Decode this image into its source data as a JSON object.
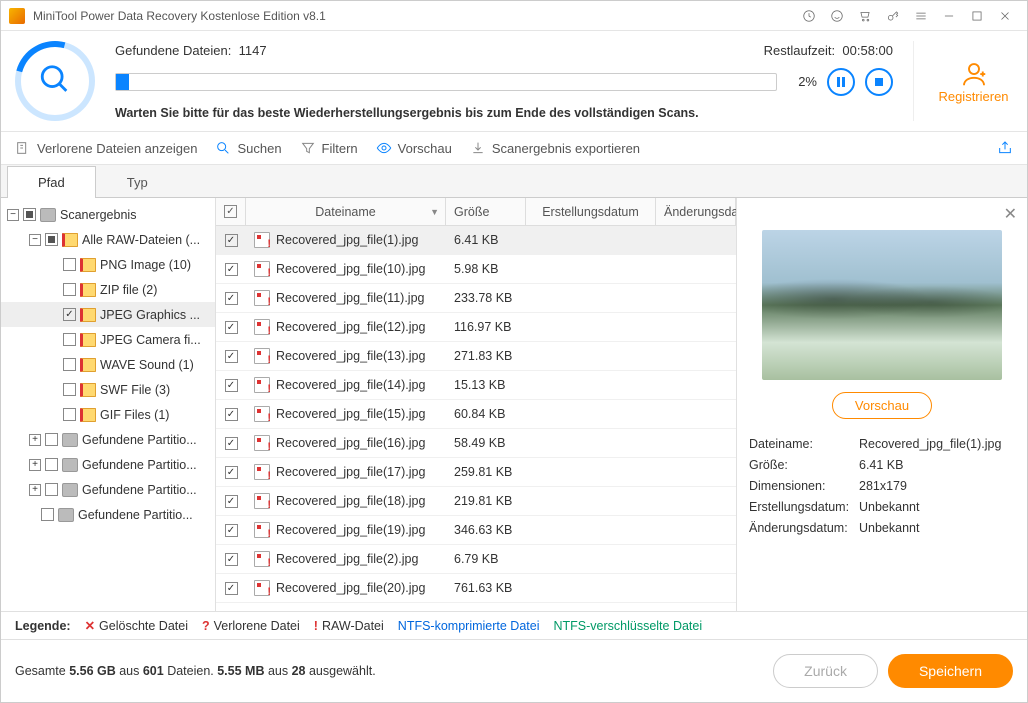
{
  "title": "MiniTool Power Data Recovery Kostenlose Edition v8.1",
  "scan": {
    "found_label": "Gefundene Dateien:",
    "found_count": "1147",
    "time_label": "Restlaufzeit:",
    "time_value": "00:58:00",
    "percent": "2%",
    "message": "Warten Sie bitte für das beste Wiederherstellungsergebnis bis zum Ende des vollständigen Scans."
  },
  "register": "Registrieren",
  "toolbar": {
    "lost": "Verlorene Dateien anzeigen",
    "search": "Suchen",
    "filter": "Filtern",
    "preview": "Vorschau",
    "export": "Scanergebnis exportieren"
  },
  "tabs": {
    "path": "Pfad",
    "type": "Typ"
  },
  "tree": {
    "root": "Scanergebnis",
    "raw": "Alle RAW-Dateien (...",
    "items": [
      "PNG Image (10)",
      "ZIP file (2)",
      "JPEG Graphics ...",
      "JPEG Camera fi...",
      "WAVE Sound (1)",
      "SWF File (3)",
      "GIF Files (1)"
    ],
    "parts": [
      "Gefundene Partitio...",
      "Gefundene Partitio...",
      "Gefundene Partitio...",
      "Gefundene Partitio..."
    ]
  },
  "table": {
    "head": {
      "name": "Dateiname",
      "size": "Größe",
      "created": "Erstellungsdatum",
      "modified": "Änderungsda"
    },
    "rows": [
      {
        "name": "Recovered_jpg_file(1).jpg",
        "size": "6.41 KB"
      },
      {
        "name": "Recovered_jpg_file(10).jpg",
        "size": "5.98 KB"
      },
      {
        "name": "Recovered_jpg_file(11).jpg",
        "size": "233.78 KB"
      },
      {
        "name": "Recovered_jpg_file(12).jpg",
        "size": "116.97 KB"
      },
      {
        "name": "Recovered_jpg_file(13).jpg",
        "size": "271.83 KB"
      },
      {
        "name": "Recovered_jpg_file(14).jpg",
        "size": "15.13 KB"
      },
      {
        "name": "Recovered_jpg_file(15).jpg",
        "size": "60.84 KB"
      },
      {
        "name": "Recovered_jpg_file(16).jpg",
        "size": "58.49 KB"
      },
      {
        "name": "Recovered_jpg_file(17).jpg",
        "size": "259.81 KB"
      },
      {
        "name": "Recovered_jpg_file(18).jpg",
        "size": "219.81 KB"
      },
      {
        "name": "Recovered_jpg_file(19).jpg",
        "size": "346.63 KB"
      },
      {
        "name": "Recovered_jpg_file(2).jpg",
        "size": "6.79 KB"
      },
      {
        "name": "Recovered_jpg_file(20).jpg",
        "size": "761.63 KB"
      }
    ]
  },
  "preview": {
    "button": "Vorschau",
    "labels": {
      "name": "Dateiname:",
      "size": "Größe:",
      "dim": "Dimensionen:",
      "created": "Erstellungsdatum:",
      "modified": "Änderungsdatum:"
    },
    "values": {
      "name": "Recovered_jpg_file(1).jpg",
      "size": "6.41 KB",
      "dim": "281x179",
      "created": "Unbekannt",
      "modified": "Unbekannt"
    }
  },
  "legend": {
    "label": "Legende:",
    "deleted": "Gelöschte Datei",
    "lost": "Verlorene Datei",
    "raw": "RAW-Datei",
    "ntfs_c": "NTFS-komprimierte Datei",
    "ntfs_e": "NTFS-verschlüsselte Datei"
  },
  "footer": {
    "stats_html": [
      "Gesamte ",
      "5.56 GB",
      " aus ",
      "601",
      " Dateien. ",
      "5.55 MB",
      " aus ",
      "28",
      " ausgewählt."
    ],
    "back": "Zurück",
    "save": "Speichern"
  }
}
